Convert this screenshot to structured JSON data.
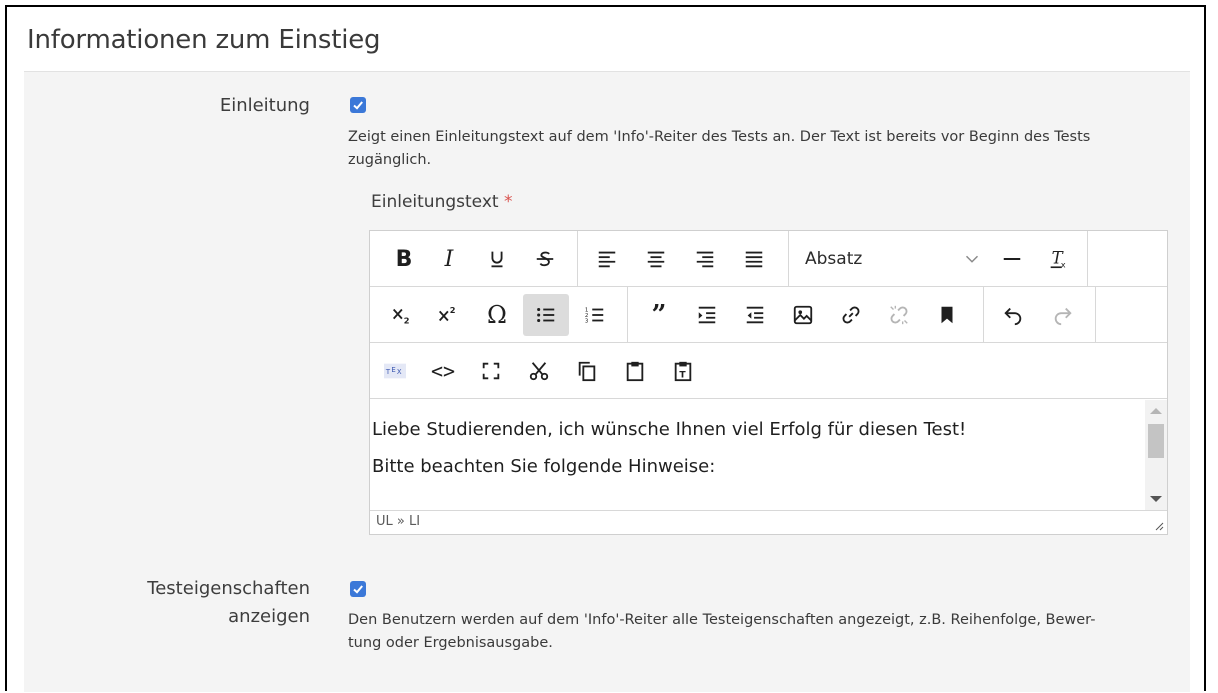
{
  "section": {
    "title": "Informationen zum Einstieg"
  },
  "intro": {
    "label": "Einleitung",
    "checked": true,
    "help": "Zeigt einen Einleitungstext auf dem 'Info'-Reiter des Tests an. Der Text ist bereits vor Beginn des Tests zugänglich.",
    "help_line1": "Zeigt einen Einleitungstext auf dem 'Info'-Reiter des Tests an. Der Text ist bereits vor Beginn des Tests",
    "help_line2": "zugänglich."
  },
  "editor": {
    "label": "Einleitungstext",
    "required_marker": "*",
    "format_select": "Absatz",
    "content": [
      "Liebe Studierenden, ich wünsche Ihnen viel Erfolg für diesen Test!",
      "Bitte beachten Sie folgende Hinweise:"
    ],
    "statusbar_path": "UL » LI",
    "toolbar_icons": {
      "row1": [
        "bold-icon",
        "italic-icon",
        "underline-icon",
        "strikethrough-icon",
        "align-left-icon",
        "align-center-icon",
        "align-right-icon",
        "align-justify-icon",
        "format-select",
        "horizontal-rule-icon",
        "clear-formatting-icon"
      ],
      "row2": [
        "subscript-icon",
        "superscript-icon",
        "special-char-icon",
        "bullet-list-icon",
        "numbered-list-icon",
        "blockquote-icon",
        "indent-icon",
        "outdent-icon",
        "image-icon",
        "link-icon",
        "unlink-icon",
        "bookmark-icon",
        "undo-icon",
        "redo-icon"
      ],
      "row3": [
        "tex-icon",
        "source-code-icon",
        "fullscreen-icon",
        "cut-icon",
        "copy-icon",
        "paste-icon",
        "paste-text-icon"
      ]
    },
    "active_button": "bullet-list-icon"
  },
  "properties": {
    "label_line1": "Testeigenschaften",
    "label_line2": "anzeigen",
    "checked": true,
    "help_line1": "Den Benutzern werden auf dem 'Info'-Reiter alle Testeigenschaften angezeigt, z.B. Reihenfolge, Bewer-",
    "help_line2": "tung oder Ergebnisausgabe."
  },
  "colors": {
    "accent": "#3b78d8",
    "required": "#d9534f",
    "panel": "#f4f4f4"
  }
}
